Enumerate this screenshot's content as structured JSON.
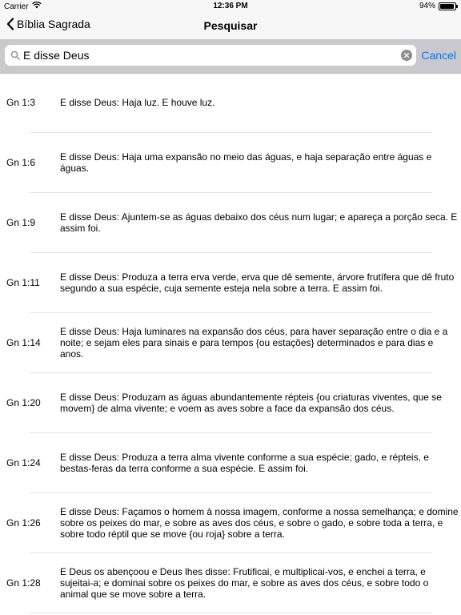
{
  "status": {
    "carrier": "Carrier",
    "time": "12:36 PM",
    "battery": "94%",
    "battery_level": 0.94
  },
  "nav": {
    "back_label": "Bíblia Sagrada",
    "title": "Pesquisar"
  },
  "search": {
    "value": "E disse Deus",
    "cancel_label": "Cancel"
  },
  "results": [
    {
      "ref": "Gn 1:3",
      "text": "E disse Deus: Haja luz. E houve luz."
    },
    {
      "ref": "Gn 1:6",
      "text": "E disse Deus: Haja uma expansão no meio das águas, e haja separação entre águas e águas."
    },
    {
      "ref": "Gn 1:9",
      "text": "E disse Deus: Ajuntem-se as águas debaixo dos céus num lugar; e apareça a porção seca. E assim foi."
    },
    {
      "ref": "Gn 1:11",
      "text": "E disse Deus: Produza a terra erva verde, erva que dê semente, árvore frutífera que dê fruto segundo a sua espécie, cuja semente esteja nela sobre a terra. E assim foi."
    },
    {
      "ref": "Gn 1:14",
      "text": "E disse Deus: Haja luminares na expansão dos céus, para haver separação entre o dia e a noite; e sejam eles para sinais e para tempos {ou estações} determinados e para dias e anos."
    },
    {
      "ref": "Gn 1:20",
      "text": "E disse Deus: Produzam as águas abundantemente répteis {ou criaturas viventes, que se movem} de alma vivente; e voem as aves sobre a face da expansão dos céus."
    },
    {
      "ref": "Gn 1:24",
      "text": "E disse Deus: Produza a terra alma vivente conforme a sua espécie; gado, e répteis, e bestas-feras da terra conforme a sua espécie. E assim foi."
    },
    {
      "ref": "Gn 1:26",
      "text": "E disse Deus: Façamos o homem à nossa imagem, conforme a nossa semelhança; e domine sobre os peixes do mar, e sobre as aves dos céus, e sobre o gado, e sobre toda a terra, e sobre todo réptil que se move {ou roja} sobre a terra."
    },
    {
      "ref": "Gn 1:28",
      "text": "E Deus os abençoou e Deus lhes disse: Frutificai, e multiplicai-vos, e enchei a terra, e sujeitai-a; e dominai sobre os peixes do mar, e sobre as aves dos céus, e sobre todo o animal que se move sobre a terra."
    }
  ]
}
